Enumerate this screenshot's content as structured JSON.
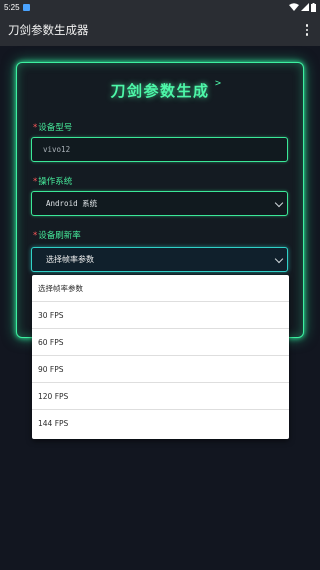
{
  "status_bar": {
    "time": "5:25"
  },
  "app_bar": {
    "title": "刀剑参数生成器"
  },
  "card": {
    "title": "刀剑参数生成",
    "title_arrow": ">"
  },
  "device_model": {
    "required_mark": "*",
    "label": "设备型号",
    "value": "vivo12"
  },
  "os": {
    "required_mark": "*",
    "label": "操作系统",
    "selected": "Android 系统"
  },
  "refresh_rate": {
    "required_mark": "*",
    "label": "设备刷新率",
    "selected": "选择帧率参数",
    "options": [
      "选择帧率参数",
      "30 FPS",
      "60 FPS",
      "90 FPS",
      "120 FPS",
      "144 FPS"
    ]
  },
  "colors": {
    "accent": "#3DF0A0",
    "background": "#121620",
    "app_bar": "#2A2D33",
    "required": "#FF5A5A"
  }
}
